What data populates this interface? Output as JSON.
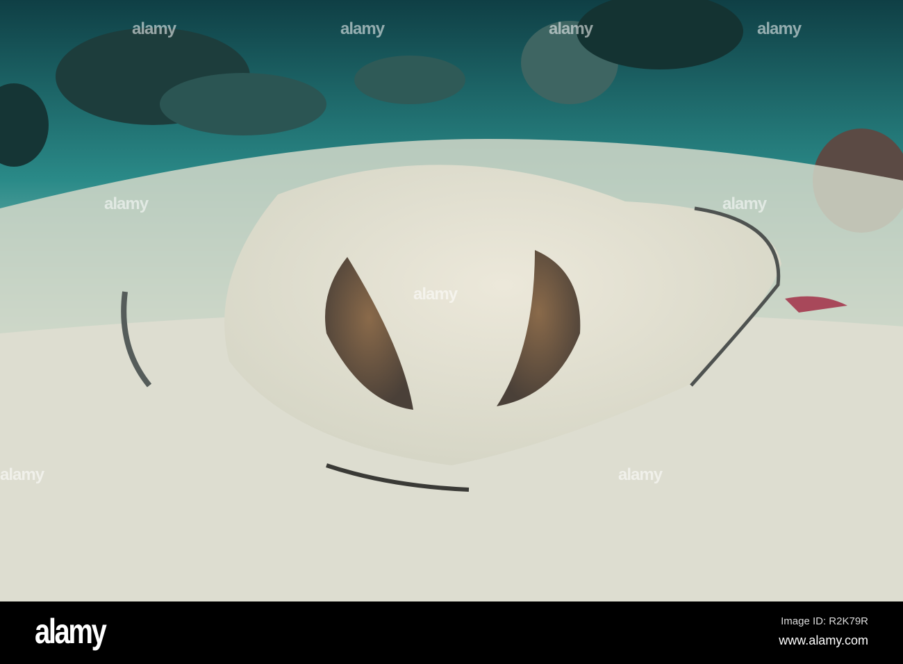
{
  "footer": {
    "logo": "alamy",
    "image_id": "Image ID: R2K79R",
    "website": "www.alamy.com"
  },
  "watermark": "alamy",
  "colors": {
    "water": "#1f6e6e",
    "sand": "#d8dccd",
    "ray_spot": "#7a5a3c"
  }
}
